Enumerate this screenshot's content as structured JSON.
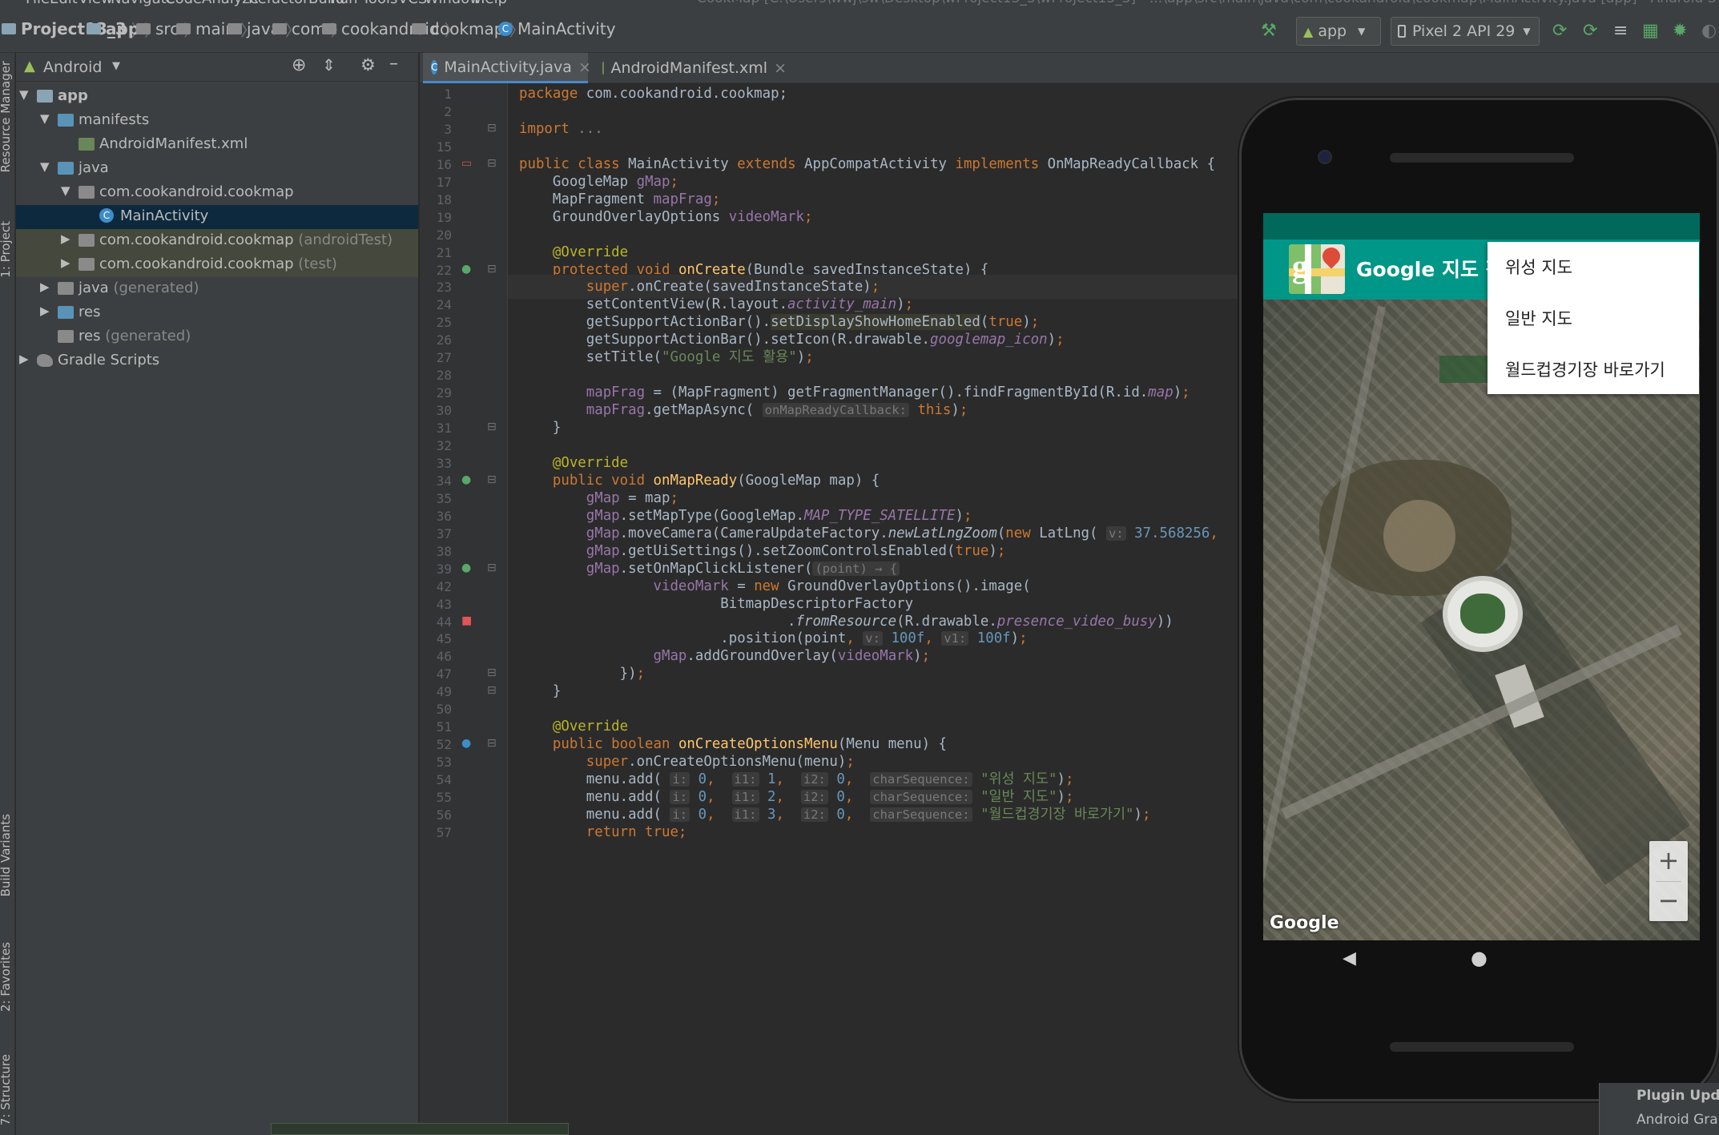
{
  "colors": {
    "ide_bg": "#2b2b2b",
    "panel": "#3c3f41",
    "keyword": "#cc7832",
    "annotation": "#bbb529",
    "method": "#ffc66d",
    "field": "#9876aa",
    "string": "#6a8759",
    "number": "#6897bb",
    "teal": "#009688",
    "teal_dark": "#00695c",
    "run_green": "#59a869"
  },
  "menubar": {
    "items": [
      "File",
      "Edit",
      "View",
      "Navigate",
      "Code",
      "Analyze",
      "Refactor",
      "Build",
      "Run",
      "Tools",
      "VCS",
      "Window",
      "Help"
    ],
    "title": "CookMap [C:\\Users\\wwj\\sw\\Desktop\\wProject13_3\\wProject13_3] - ...\\app\\src\\main\\java\\com\\cookandroid\\cookmap\\MainActivity.java [app] - Android S"
  },
  "breadcrumb": [
    "Project13_3",
    "app",
    "src",
    "main",
    "java",
    "com",
    "cookandroid",
    "cookmap",
    "MainActivity"
  ],
  "toolbar": {
    "run_config": "app",
    "device": "Pixel 2 API 29",
    "icons": [
      "hammer-icon",
      "android-icon",
      "run-icon",
      "apply-changes-icon",
      "apply-code-changes-icon",
      "coverage-icon",
      "debug-icon",
      "profile-icon",
      "attach-debugger-icon"
    ]
  },
  "left_strip": {
    "tabs": [
      "Resource Manager",
      "1: Project",
      "Build Variants",
      "2: Favorites",
      "7: Structure"
    ]
  },
  "project": {
    "view_label": "Android",
    "header_icons": [
      "locate-icon",
      "collapse-icon",
      "gear-icon",
      "minimize-icon"
    ],
    "tree": [
      {
        "label": "app",
        "suffix": "",
        "depth": 0,
        "expanded": true,
        "icon": "module-folder-icon"
      },
      {
        "label": "manifests",
        "suffix": "",
        "depth": 1,
        "expanded": true,
        "icon": "folder-icon"
      },
      {
        "label": "AndroidManifest.xml",
        "suffix": "",
        "depth": 2,
        "expanded": null,
        "icon": "manifest-file-icon"
      },
      {
        "label": "java",
        "suffix": "",
        "depth": 1,
        "expanded": true,
        "icon": "folder-icon"
      },
      {
        "label": "com.cookandroid.cookmap",
        "suffix": "",
        "depth": 2,
        "expanded": true,
        "icon": "package-icon"
      },
      {
        "label": "MainActivity",
        "suffix": "",
        "depth": 3,
        "expanded": null,
        "icon": "class-icon"
      },
      {
        "label": "com.cookandroid.cookmap",
        "suffix": "(androidTest)",
        "depth": 2,
        "expanded": false,
        "icon": "package-icon"
      },
      {
        "label": "com.cookandroid.cookmap",
        "suffix": "(test)",
        "depth": 2,
        "expanded": false,
        "icon": "package-icon"
      },
      {
        "label": "java",
        "suffix": "(generated)",
        "depth": 1,
        "expanded": false,
        "icon": "generated-folder-icon"
      },
      {
        "label": "res",
        "suffix": "",
        "depth": 1,
        "expanded": false,
        "icon": "res-folder-icon"
      },
      {
        "label": "res",
        "suffix": "(generated)",
        "depth": 1,
        "expanded": null,
        "icon": "res-folder-icon"
      },
      {
        "label": "Gradle Scripts",
        "suffix": "",
        "depth": 0,
        "expanded": false,
        "icon": "gradle-icon"
      }
    ]
  },
  "editor": {
    "tabs": [
      {
        "label": "MainActivity.java",
        "active": true
      },
      {
        "label": "AndroidManifest.xml",
        "active": false
      }
    ],
    "lines": [
      {
        "n": "1",
        "s": [
          [
            "kw",
            "package "
          ],
          [
            "plain",
            "com.cookandroid.cookmap;"
          ]
        ]
      },
      {
        "n": "2",
        "s": []
      },
      {
        "n": "3",
        "s": [
          [
            "kw",
            "import "
          ],
          [
            "dim",
            "..."
          ]
        ]
      },
      {
        "n": "15",
        "s": []
      },
      {
        "n": "16",
        "s": [
          [
            "kw",
            "public class "
          ],
          [
            "plain",
            "MainActivity "
          ],
          [
            "kw",
            "extends "
          ],
          [
            "plain",
            "AppCompatActivity "
          ],
          [
            "kw",
            "implements "
          ],
          [
            "plain",
            "OnMapReadyCallback {"
          ]
        ]
      },
      {
        "n": "17",
        "s": [
          [
            "plain",
            "    GoogleMap "
          ],
          [
            "fld",
            "gMap"
          ],
          [
            "kw",
            ";"
          ]
        ]
      },
      {
        "n": "18",
        "s": [
          [
            "plain",
            "    MapFragment "
          ],
          [
            "fld",
            "mapFrag"
          ],
          [
            "kw",
            ";"
          ]
        ]
      },
      {
        "n": "19",
        "s": [
          [
            "plain",
            "    GroundOverlayOptions "
          ],
          [
            "fld",
            "videoMark"
          ],
          [
            "kw",
            ";"
          ]
        ]
      },
      {
        "n": "20",
        "s": []
      },
      {
        "n": "21",
        "s": [
          [
            "ann",
            "    @Override"
          ]
        ]
      },
      {
        "n": "22",
        "s": [
          [
            "kw",
            "    protected void "
          ],
          [
            "fn",
            "onCreate"
          ],
          [
            "plain",
            "(Bundle savedInstanceState) {"
          ]
        ]
      },
      {
        "n": "23",
        "s": [
          [
            "kw",
            "        super"
          ],
          [
            "plain",
            ".onCreate(savedInstanceState)"
          ],
          [
            "kw",
            ";"
          ]
        ]
      },
      {
        "n": "24",
        "s": [
          [
            "plain",
            "        setContentView(R.layout."
          ],
          [
            "fld it",
            "activity_main"
          ],
          [
            "plain",
            ")"
          ],
          [
            "kw",
            ";"
          ]
        ]
      },
      {
        "n": "25",
        "s": [
          [
            "plain",
            "        getSupportActionBar()."
          ],
          [
            "plain selw",
            "setDisplayShowHomeEnabled"
          ],
          [
            "plain",
            "("
          ],
          [
            "kw",
            "true"
          ],
          [
            "plain",
            ")"
          ],
          [
            "kw",
            ";"
          ]
        ]
      },
      {
        "n": "26",
        "s": [
          [
            "plain",
            "        getSupportActionBar().setIcon(R.drawable."
          ],
          [
            "fld it",
            "googlemap_icon"
          ],
          [
            "plain",
            ")"
          ],
          [
            "kw",
            ";"
          ]
        ]
      },
      {
        "n": "27",
        "s": [
          [
            "plain",
            "        setTitle("
          ],
          [
            "str",
            "\"Google 지도 활용\""
          ],
          [
            "plain",
            ")"
          ],
          [
            "kw",
            ";"
          ]
        ]
      },
      {
        "n": "28",
        "s": []
      },
      {
        "n": "29",
        "s": [
          [
            "fld",
            "        mapFrag"
          ],
          [
            "plain",
            " = (MapFragment) getFragmentManager().findFragmentById(R.id."
          ],
          [
            "fld it",
            "map"
          ],
          [
            "plain",
            ")"
          ],
          [
            "kw",
            ";"
          ]
        ]
      },
      {
        "n": "30",
        "s": [
          [
            "fld",
            "        mapFrag"
          ],
          [
            "plain",
            ".getMapAsync( "
          ],
          [
            "hint",
            "onMapReadyCallback:"
          ],
          [
            "kw",
            " this"
          ],
          [
            "plain",
            ")"
          ],
          [
            "kw",
            ";"
          ]
        ]
      },
      {
        "n": "31",
        "s": [
          [
            "plain",
            "    }"
          ]
        ]
      },
      {
        "n": "32",
        "s": []
      },
      {
        "n": "33",
        "s": [
          [
            "ann",
            "    @Override"
          ]
        ]
      },
      {
        "n": "34",
        "s": [
          [
            "kw",
            "    public void "
          ],
          [
            "fn",
            "onMapReady"
          ],
          [
            "plain",
            "(GoogleMap map) {"
          ]
        ]
      },
      {
        "n": "35",
        "s": [
          [
            "fld",
            "        gMap"
          ],
          [
            "plain",
            " = map"
          ],
          [
            "kw",
            ";"
          ]
        ]
      },
      {
        "n": "36",
        "s": [
          [
            "fld",
            "        gMap"
          ],
          [
            "plain",
            ".setMapType(GoogleMap."
          ],
          [
            "fld it",
            "MAP_TYPE_SATELLITE"
          ],
          [
            "plain",
            ")"
          ],
          [
            "kw",
            ";"
          ]
        ]
      },
      {
        "n": "37",
        "s": [
          [
            "fld",
            "        gMap"
          ],
          [
            "plain",
            ".moveCamera(CameraUpdateFactory."
          ],
          [
            "plain it",
            "newLatLngZoom"
          ],
          [
            "plain",
            "("
          ],
          [
            "kw",
            "new "
          ],
          [
            "plain",
            "LatLng( "
          ],
          [
            "hint",
            "v:"
          ],
          [
            "num",
            " 37.568256"
          ],
          [
            "kw",
            ","
          ]
        ]
      },
      {
        "n": "38",
        "s": [
          [
            "fld",
            "        gMap"
          ],
          [
            "plain",
            ".getUiSettings().setZoomControlsEnabled("
          ],
          [
            "kw",
            "true"
          ],
          [
            "plain",
            ")"
          ],
          [
            "kw",
            ";"
          ]
        ]
      },
      {
        "n": "39",
        "s": [
          [
            "fld",
            "        gMap"
          ],
          [
            "plain",
            ".setOnMapClickListener("
          ],
          [
            "hint",
            "(point) → {"
          ]
        ]
      },
      {
        "n": "42",
        "s": [
          [
            "fld",
            "                videoMark"
          ],
          [
            "plain",
            " = "
          ],
          [
            "kw",
            "new "
          ],
          [
            "plain",
            "GroundOverlayOptions().image("
          ]
        ]
      },
      {
        "n": "43",
        "s": [
          [
            "plain",
            "                        BitmapDescriptorFactory"
          ]
        ]
      },
      {
        "n": "44",
        "s": [
          [
            "plain",
            "                                ."
          ],
          [
            "plain it",
            "fromResource"
          ],
          [
            "plain",
            "(R.drawable."
          ],
          [
            "fld it",
            "presence_video_busy"
          ],
          [
            "plain",
            "))"
          ]
        ]
      },
      {
        "n": "45",
        "s": [
          [
            "plain",
            "                        .position(point"
          ],
          [
            "kw",
            ", "
          ],
          [
            "hint",
            "v:"
          ],
          [
            "num",
            " 100f"
          ],
          [
            "kw",
            ", "
          ],
          [
            "hint",
            "v1:"
          ],
          [
            "num",
            " 100f"
          ],
          [
            "plain",
            ")"
          ],
          [
            "kw",
            ";"
          ]
        ]
      },
      {
        "n": "46",
        "s": [
          [
            "fld",
            "                gMap"
          ],
          [
            "plain",
            ".addGroundOverlay("
          ],
          [
            "fld",
            "videoMark"
          ],
          [
            "plain",
            ")"
          ],
          [
            "kw",
            ";"
          ]
        ]
      },
      {
        "n": "47",
        "s": [
          [
            "plain",
            "            })"
          ],
          [
            "kw",
            ";"
          ]
        ]
      },
      {
        "n": "49",
        "s": [
          [
            "plain",
            "    }"
          ]
        ]
      },
      {
        "n": "50",
        "s": []
      },
      {
        "n": "51",
        "s": [
          [
            "ann",
            "    @Override"
          ]
        ]
      },
      {
        "n": "52",
        "s": [
          [
            "kw",
            "    public boolean "
          ],
          [
            "fn",
            "onCreateOptionsMenu"
          ],
          [
            "plain",
            "(Menu menu) {"
          ]
        ]
      },
      {
        "n": "53",
        "s": [
          [
            "kw",
            "        super"
          ],
          [
            "plain",
            ".onCreateOptionsMenu(menu)"
          ],
          [
            "kw",
            ";"
          ]
        ]
      },
      {
        "n": "54",
        "s": [
          [
            "plain",
            "        menu.add( "
          ],
          [
            "hint",
            "i:"
          ],
          [
            "num",
            " 0"
          ],
          [
            "kw",
            ",  "
          ],
          [
            "hint",
            "i1:"
          ],
          [
            "num",
            " 1"
          ],
          [
            "kw",
            ",  "
          ],
          [
            "hint",
            "i2:"
          ],
          [
            "num",
            " 0"
          ],
          [
            "kw",
            ",  "
          ],
          [
            "hint",
            "charSequence:"
          ],
          [
            "str",
            " \"위성 지도\""
          ],
          [
            "plain",
            ")"
          ],
          [
            "kw",
            ";"
          ]
        ]
      },
      {
        "n": "55",
        "s": [
          [
            "plain",
            "        menu.add( "
          ],
          [
            "hint",
            "i:"
          ],
          [
            "num",
            " 0"
          ],
          [
            "kw",
            ",  "
          ],
          [
            "hint",
            "i1:"
          ],
          [
            "num",
            " 2"
          ],
          [
            "kw",
            ",  "
          ],
          [
            "hint",
            "i2:"
          ],
          [
            "num",
            " 0"
          ],
          [
            "kw",
            ",  "
          ],
          [
            "hint",
            "charSequence:"
          ],
          [
            "str",
            " \"일반 지도\""
          ],
          [
            "plain",
            ")"
          ],
          [
            "kw",
            ";"
          ]
        ]
      },
      {
        "n": "56",
        "s": [
          [
            "plain",
            "        menu.add( "
          ],
          [
            "hint",
            "i:"
          ],
          [
            "num",
            " 0"
          ],
          [
            "kw",
            ",  "
          ],
          [
            "hint",
            "i1:"
          ],
          [
            "num",
            " 3"
          ],
          [
            "kw",
            ",  "
          ],
          [
            "hint",
            "i2:"
          ],
          [
            "num",
            " 0"
          ],
          [
            "kw",
            ",  "
          ],
          [
            "hint",
            "charSequence:"
          ],
          [
            "str",
            " \"월드컵경기장 바로가기\""
          ],
          [
            "plain",
            ")"
          ],
          [
            "kw",
            ";"
          ]
        ]
      },
      {
        "n": "57",
        "s": [
          [
            "kw",
            "        return true;"
          ]
        ]
      }
    ]
  },
  "emulator": {
    "app_title": "Google 지도 활용",
    "menu": [
      "위성 지도",
      "일반 지도",
      "월드컵경기장 바로가기"
    ],
    "zoom_in": "+",
    "zoom_out": "−",
    "map_logo": "Google",
    "nav_back": "◀",
    "nav_home": "●"
  },
  "notification": {
    "title": "Plugin Upda",
    "subtitle": "Android Gra"
  }
}
